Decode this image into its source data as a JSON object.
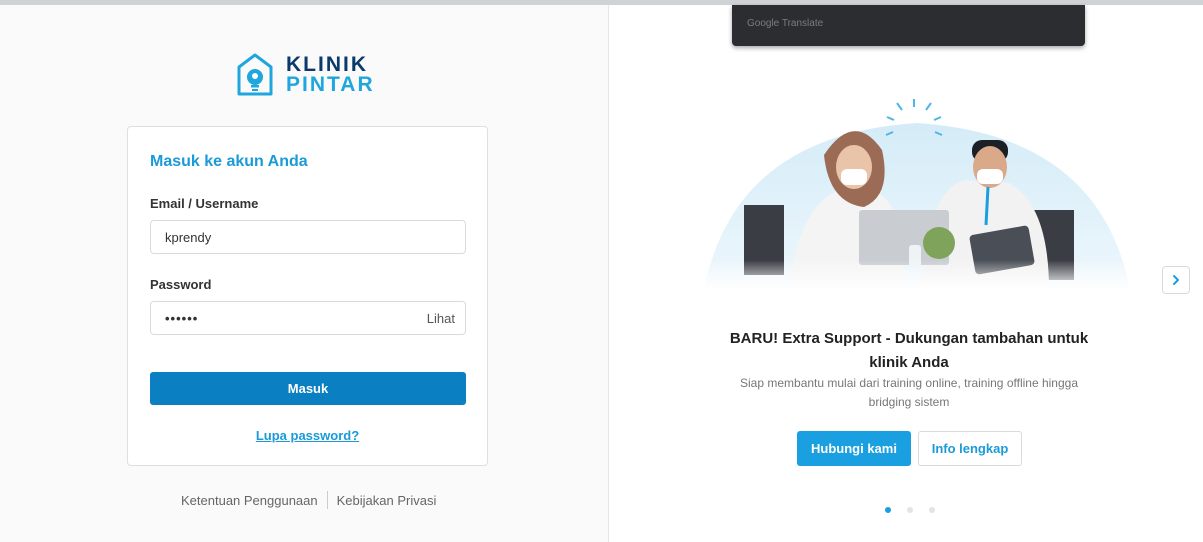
{
  "brand": {
    "line1": "KLINIK",
    "line2": "PINTAR"
  },
  "login": {
    "title": "Masuk ke akun Anda",
    "email_label": "Email / Username",
    "email_value": "kprendy",
    "password_label": "Password",
    "password_value": "••••••",
    "show_password": "Lihat",
    "submit": "Masuk",
    "forgot": "Lupa password?"
  },
  "footer": {
    "terms": "Ketentuan Penggunaan",
    "privacy": "Kebijakan Privasi"
  },
  "tooltip": {
    "text": "Google Translate"
  },
  "promo": {
    "title": "BARU! Extra Support - Dukungan tambahan untuk klinik Anda",
    "subtitle": "Siap membantu mulai dari training online, training offline hingga bridging sistem",
    "primary_button": "Hubungi kami",
    "secondary_button": "Info lengkap",
    "slides_total": 3,
    "active_slide": 1
  },
  "colors": {
    "accent": "#1aa0e0",
    "primary_button": "#0a7fc2",
    "brand_dark": "#0a3a6b"
  },
  "icons": {
    "logo": "house-bulb-icon",
    "next": "chevron-right-icon"
  }
}
